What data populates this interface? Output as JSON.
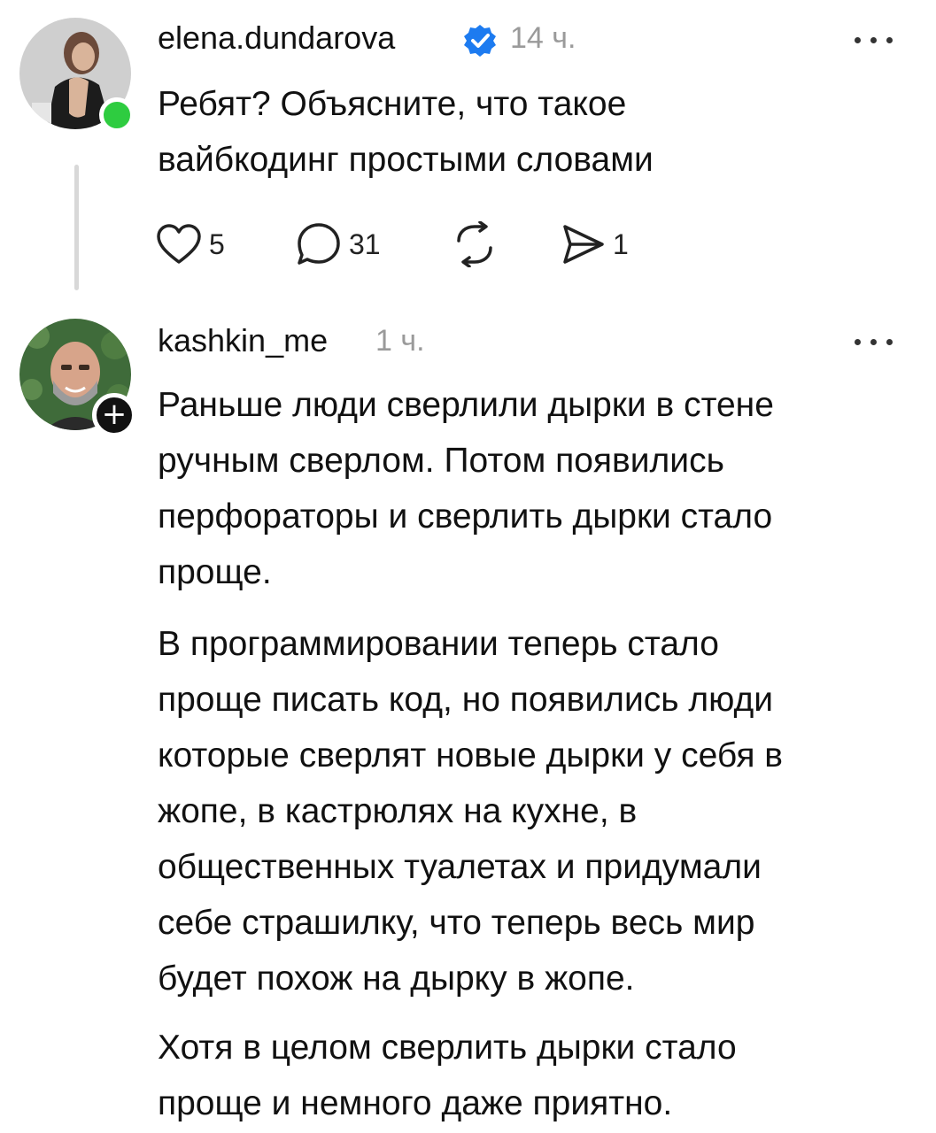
{
  "post": {
    "username": "elena.dundarova",
    "time": "14 ч.",
    "text_lines": [
      "Ребят? Объясните, что такое",
      "вайбкодинг простыми словами"
    ],
    "actions": {
      "likes": "5",
      "comments": "31",
      "shares": "1"
    }
  },
  "reply": {
    "username": "kashkin_me",
    "time": "1 ч.",
    "paragraphs": [
      [
        "Раньше люди сверлили дырки в стене",
        "ручным сверлом. Потом появились",
        "перфораторы и сверлить дырки стало",
        "проще."
      ],
      [
        "В программировании теперь стало",
        "проще писать код, но появились люди",
        "которые сверлят новые дырки у себя в",
        "жопе, в кастрюлях на кухне, в",
        "общественных туалетах и придумали",
        "себе страшилку, что теперь весь мир",
        "будет похож на дырку в жопе."
      ],
      [
        "Хотя в целом сверлить дырки стало",
        "проще и немного даже приятно."
      ]
    ]
  },
  "icons": {
    "verified": "verified-badge-icon",
    "like": "heart-icon",
    "comment": "comment-bubble-icon",
    "repost": "repost-icon",
    "share": "send-icon",
    "more": "more-dots-icon",
    "follow": "plus-icon"
  },
  "colors": {
    "verified_blue": "#1d7bf0",
    "online_green": "#2ecc40",
    "muted_gray": "#9a9a9a",
    "thread_line": "#d8d8d8"
  }
}
